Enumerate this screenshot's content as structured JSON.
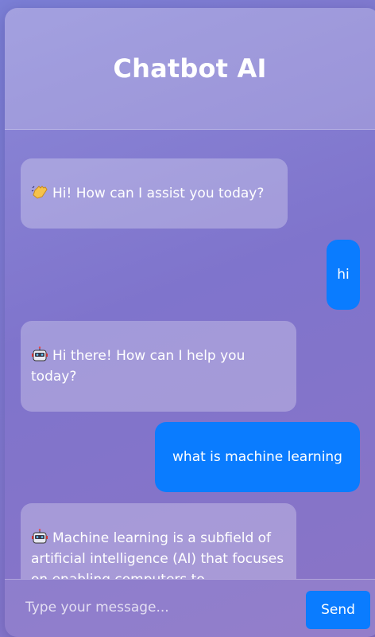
{
  "header": {
    "title": "Chatbot AI"
  },
  "messages": [
    {
      "sender": "bot",
      "icon": "waving-hand-icon",
      "text": "Hi! How can I assist you today?"
    },
    {
      "sender": "user",
      "text": "hi"
    },
    {
      "sender": "bot",
      "icon": "robot-icon",
      "text": "Hi there! How can I help you today?"
    },
    {
      "sender": "user",
      "text": "what is machine learning"
    },
    {
      "sender": "bot",
      "icon": "robot-icon",
      "text": "Machine learning is a subfield of artificial intelligence (AI) that focuses on enabling computers to"
    }
  ],
  "composer": {
    "placeholder": "Type your message...",
    "send_label": "Send"
  },
  "colors": {
    "user_bubble": "#0a7cff",
    "send_button": "#0a7cff",
    "bot_bubble": "rgba(255,255,255,0.28)"
  }
}
